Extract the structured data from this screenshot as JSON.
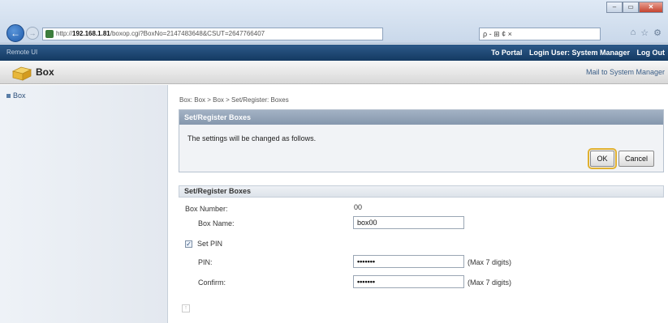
{
  "browser": {
    "address_prefix": "http://",
    "address_host": "192.168.1.81",
    "address_rest": "/boxop.cgi?BoxNo=2147483648&CSUT=2647766407",
    "search_text": "ρ - ⊞ ¢ ×",
    "window_min": "–",
    "window_max": "▭",
    "window_close": "✕"
  },
  "header": {
    "device_label": "Remote UI",
    "portal_link": "To Portal",
    "login_user": "Login User: System Manager",
    "logout": "Log Out",
    "title": "Box",
    "mailto": "Mail to System Manager"
  },
  "sidebar": {
    "items": [
      {
        "label": "Box"
      }
    ]
  },
  "main": {
    "breadcrumb": "Box: Box > Box > Set/Register: Boxes",
    "confirm_panel": {
      "title": "Set/Register Boxes",
      "message": "The settings will be changed as follows.",
      "ok_label": "OK",
      "cancel_label": "Cancel"
    },
    "form": {
      "title": "Set/Register Boxes",
      "box_number_label": "Box Number:",
      "box_number_value": "00",
      "box_name_label": "Box Name:",
      "box_name_value": "box00",
      "set_pin_label": "Set PIN",
      "set_pin_checked": true,
      "pin_label": "PIN:",
      "pin_value": "•••••••",
      "pin_hint": "(Max 7 digits)",
      "confirm_label": "Confirm:",
      "confirm_value": "•••••••",
      "confirm_hint": "(Max 7 digits)"
    }
  }
}
